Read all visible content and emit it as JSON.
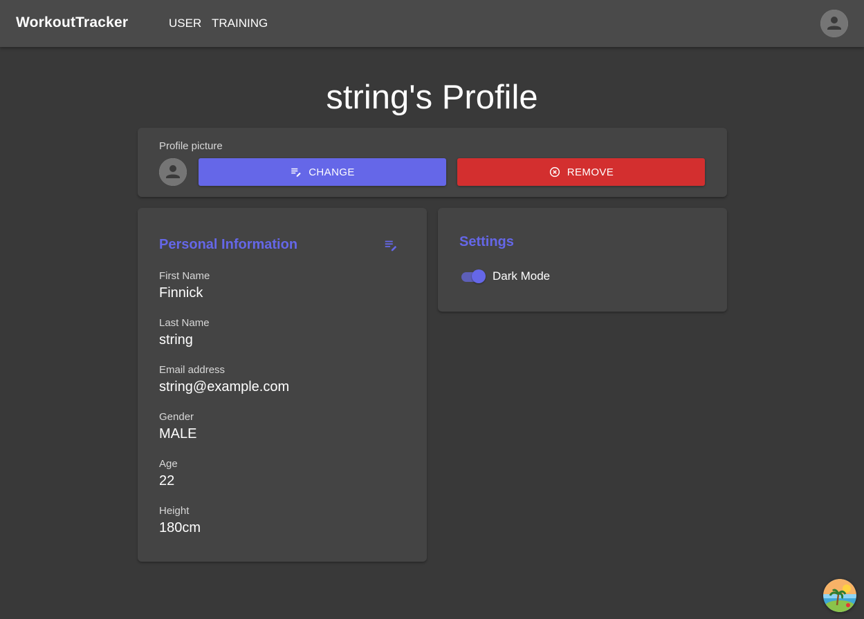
{
  "appbar": {
    "brand": "WorkoutTracker",
    "nav": [
      "USER",
      "TRAINING"
    ],
    "account_icon": "account-circle-icon"
  },
  "page": {
    "title": "string's Profile"
  },
  "profile_picture": {
    "caption": "Profile picture",
    "change_label": "CHANGE",
    "change_icon": "edit-note-icon",
    "remove_label": "REMOVE",
    "remove_icon": "cancel-circle-icon"
  },
  "personal_info": {
    "title": "Personal Information",
    "fields": [
      {
        "label": "First Name",
        "value": "Finnick"
      },
      {
        "label": "Last Name",
        "value": "string"
      },
      {
        "label": "Email address",
        "value": "string@example.com"
      },
      {
        "label": "Gender",
        "value": "MALE"
      },
      {
        "label": "Age",
        "value": "22"
      },
      {
        "label": "Height",
        "value": "180cm"
      }
    ]
  },
  "settings": {
    "title": "Settings",
    "dark_mode_label": "Dark Mode",
    "dark_mode_on": true
  },
  "colors": {
    "accent": "#6567e8",
    "danger": "#d32f2f",
    "background": "#393939",
    "card": "#444444",
    "appbar": "#4a4a4a"
  }
}
